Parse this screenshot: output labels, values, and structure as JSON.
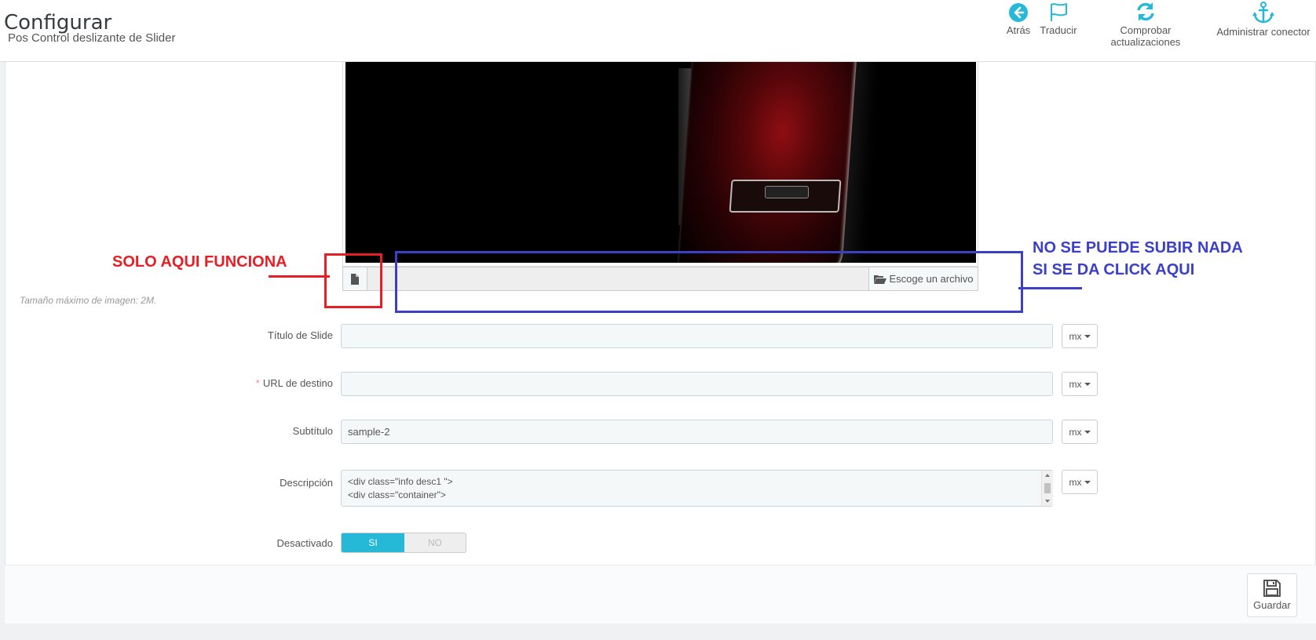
{
  "header": {
    "title": "Configurar",
    "subtitle": "Pos Control deslizante de Slider",
    "toolbar": [
      {
        "label": "Atrás",
        "icon": "back-arrow-icon"
      },
      {
        "label": "Traducir",
        "icon": "flag-icon"
      },
      {
        "label": "Comprobar actualizaciones",
        "icon": "refresh-icon"
      },
      {
        "label": "Administrar conector",
        "icon": "anchor-icon"
      }
    ]
  },
  "upload": {
    "choose_label": "Escoge un archivo",
    "help": "Tamaño máximo de imagen: 2M."
  },
  "annotations": {
    "red_text": "SOLO AQUI FUNCIONA",
    "blue_line1": "NO SE PUEDE SUBIR NADA",
    "blue_line2": "SI SE DA CLICK AQUI",
    "red_color": "#e61e26",
    "blue_color": "#3c40c6"
  },
  "form": {
    "title": {
      "label": "Título de Slide",
      "value": "",
      "lang": "mx"
    },
    "url": {
      "label": "URL de destino",
      "required_mark": "*",
      "value": "",
      "lang": "mx"
    },
    "subtitle": {
      "label": "Subtítulo",
      "value": "sample-2",
      "lang": "mx"
    },
    "description": {
      "label": "Descripción",
      "lines": [
        "<div class=\"info desc1 \">",
        "<div class=\"container\">"
      ],
      "lang": "mx"
    },
    "disabled": {
      "label": "Desactivado",
      "on": "SI",
      "off": "NO"
    }
  },
  "footer": {
    "save_label": "Guardar"
  },
  "colors": {
    "accent": "#25b9d7",
    "title": "#363a41"
  }
}
